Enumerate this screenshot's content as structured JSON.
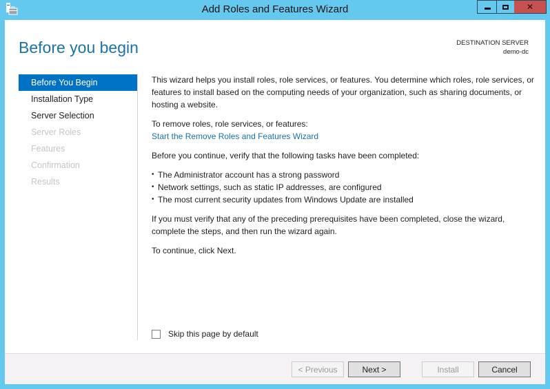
{
  "window": {
    "title": "Add Roles and Features Wizard",
    "controls": {
      "minimize": "minimize",
      "maximize": "maximize",
      "close": "✕"
    }
  },
  "header": {
    "page_title": "Before you begin",
    "destination_label": "DESTINATION SERVER",
    "destination_value": "demo-dc"
  },
  "nav": {
    "items": [
      {
        "label": "Before You Begin",
        "state": "active"
      },
      {
        "label": "Installation Type",
        "state": "enabled"
      },
      {
        "label": "Server Selection",
        "state": "enabled"
      },
      {
        "label": "Server Roles",
        "state": "disabled"
      },
      {
        "label": "Features",
        "state": "disabled"
      },
      {
        "label": "Confirmation",
        "state": "disabled"
      },
      {
        "label": "Results",
        "state": "disabled"
      }
    ]
  },
  "content": {
    "intro": "This wizard helps you install roles, role services, or features. You determine which roles, role services, or features to install based on the computing needs of your organization, such as sharing documents, or hosting a website.",
    "remove_label": "To remove roles, role services, or features:",
    "remove_link": "Start the Remove Roles and Features Wizard",
    "verify_label": "Before you continue, verify that the following tasks have been completed:",
    "tasks": [
      "The Administrator account has a strong password",
      "Network settings, such as static IP addresses, are configured",
      "The most current security updates from Windows Update are installed"
    ],
    "prereq_note": "If you must verify that any of the preceding prerequisites have been completed, close the wizard, complete the steps, and then run the wizard again.",
    "continue_note": "To continue, click Next."
  },
  "skip_checkbox": {
    "label": "Skip this page by default",
    "checked": false
  },
  "footer": {
    "previous": "< Previous",
    "next": "Next >",
    "install": "Install",
    "cancel": "Cancel"
  }
}
